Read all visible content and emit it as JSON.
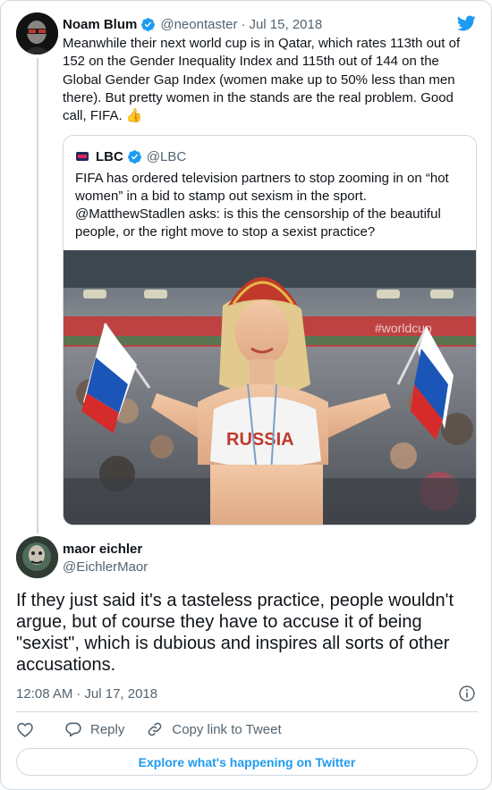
{
  "tweet": {
    "author_name": "Noam Blum",
    "author_handle": "@neontaster",
    "separator": "·",
    "date": "Jul 15, 2018",
    "text": "Meanwhile their next world cup is in Qatar, which rates 113th out of 152 on the Gender Inequality Index and 115th out of 144 on the Global Gender Gap Index (women make up to 50% less than men there). But pretty women in the stands are the real problem. Good call, FIFA.",
    "emoji": "👍"
  },
  "quoted": {
    "author_name": "LBC",
    "author_handle": "@LBC",
    "text": "FIFA has ordered television partners to stop zooming in on “hot women” in a bid to stamp out sexism in the sport. @MatthewStadlen asks: is this the censorship of the beautiful people, or the right move to stop a sexist practice?",
    "image_text": "RUSSIA",
    "stand_text": "#worldcup"
  },
  "reply": {
    "author_name": "maor eichler",
    "author_handle": "@EichlerMaor",
    "text": "If they just said it's a tasteless practice, people wouldn't argue, but of course they have to accuse it of being \"sexist\", which is dubious and inspires all sorts of other accusations.",
    "time": "12:08 AM",
    "separator": "·",
    "date": "Jul 17, 2018"
  },
  "actions": {
    "reply_label": "Reply",
    "copy_link_label": "Copy link to Tweet"
  },
  "explore_label": "Explore what's happening on Twitter",
  "icons": {
    "verified": "verified-badge-icon",
    "bird": "twitter-bird-icon",
    "info": "info-icon",
    "like": "heart-icon",
    "reply": "reply-bubble-icon",
    "link": "link-icon"
  },
  "colors": {
    "accent": "#1d9bf0",
    "text": "#0f1419",
    "muted": "#536471",
    "border": "#cfd9de"
  }
}
